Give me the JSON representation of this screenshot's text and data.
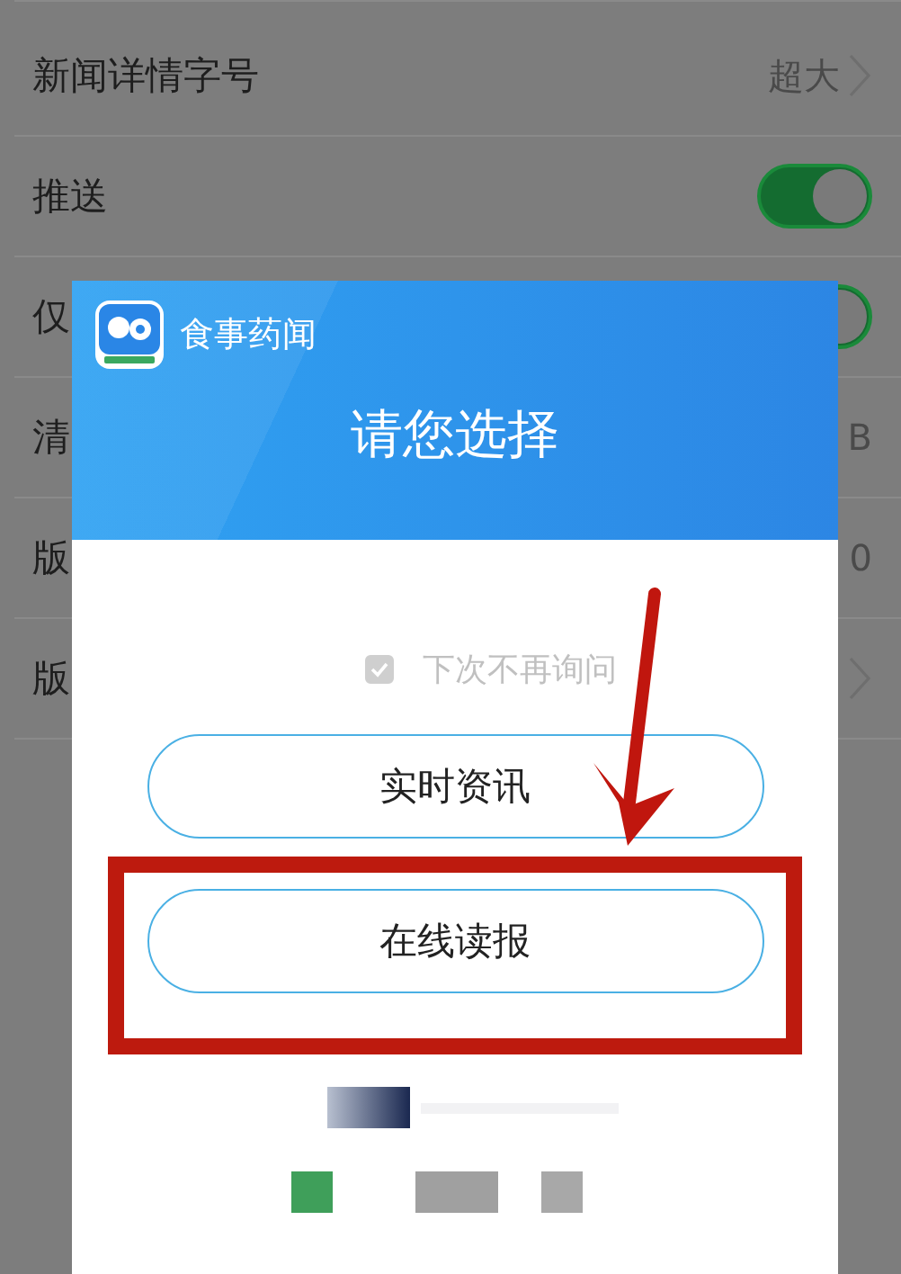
{
  "settings": [
    {
      "kind": "link",
      "label": "新闻详情字号",
      "value": "超大"
    },
    {
      "kind": "toggle",
      "label": "推送",
      "on": true
    },
    {
      "kind": "toggle",
      "label": "仅",
      "on": true
    },
    {
      "kind": "value",
      "label": "清",
      "value": "B"
    },
    {
      "kind": "value",
      "label": "版",
      "value": "0"
    },
    {
      "kind": "link",
      "label": "版"
    }
  ],
  "dialog": {
    "app_name": "食事药闻",
    "title": "请您选择",
    "remember": {
      "label": "下次不再询问",
      "checked": true
    },
    "buttons": [
      "实时资讯",
      "在线读报"
    ]
  }
}
